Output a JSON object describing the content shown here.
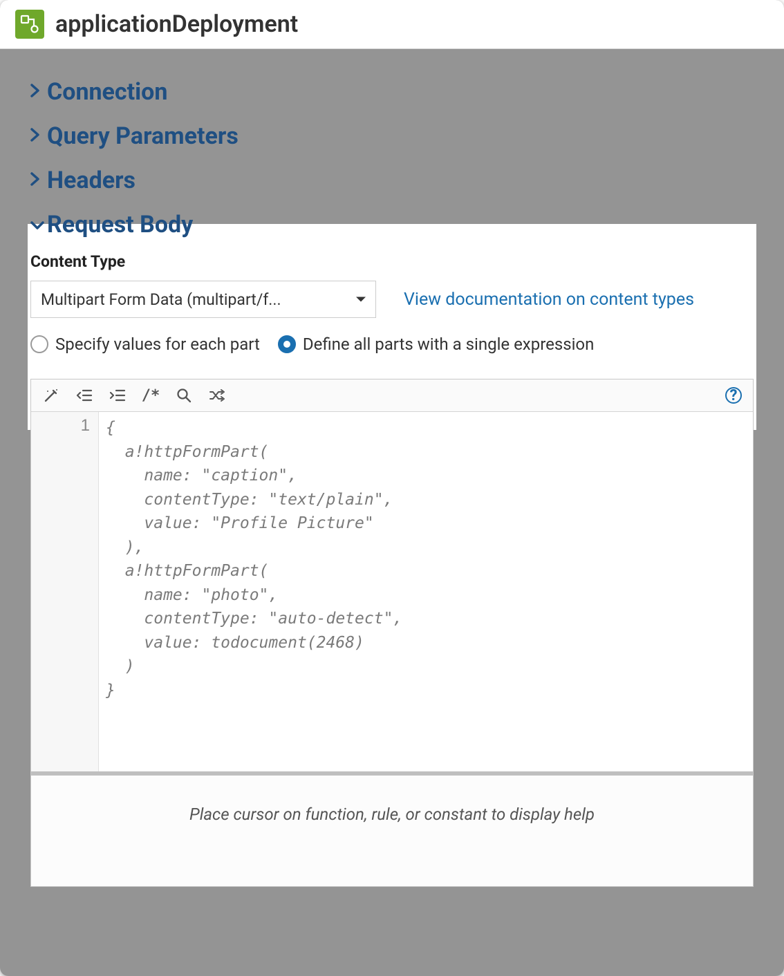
{
  "header": {
    "title": "applicationDeployment"
  },
  "sections": {
    "connection": {
      "label": "Connection"
    },
    "queryParameters": {
      "label": "Query Parameters"
    },
    "headers": {
      "label": "Headers"
    },
    "requestBody": {
      "label": "Request Body",
      "contentTypeLabel": "Content Type",
      "contentTypeSelected": "Multipart Form Data (multipart/f...",
      "docLink": "View documentation on content types",
      "radios": {
        "specifyEach": "Specify values for each part",
        "defineAll": "Define all parts with a single expression",
        "selected": "defineAll"
      }
    }
  },
  "editor": {
    "lineNumber": "1",
    "code": "{\n  a!httpFormPart(\n    name: \"caption\",\n    contentType: \"text/plain\",\n    value: \"Profile Picture\"\n  ),\n  a!httpFormPart(\n    name: \"photo\",\n    contentType: \"auto-detect\",\n    value: todocument(2468)\n  )\n}",
    "hint": "Place cursor on function, rule, or constant to display help"
  },
  "toolbar": {
    "commentLabel": "/*"
  }
}
